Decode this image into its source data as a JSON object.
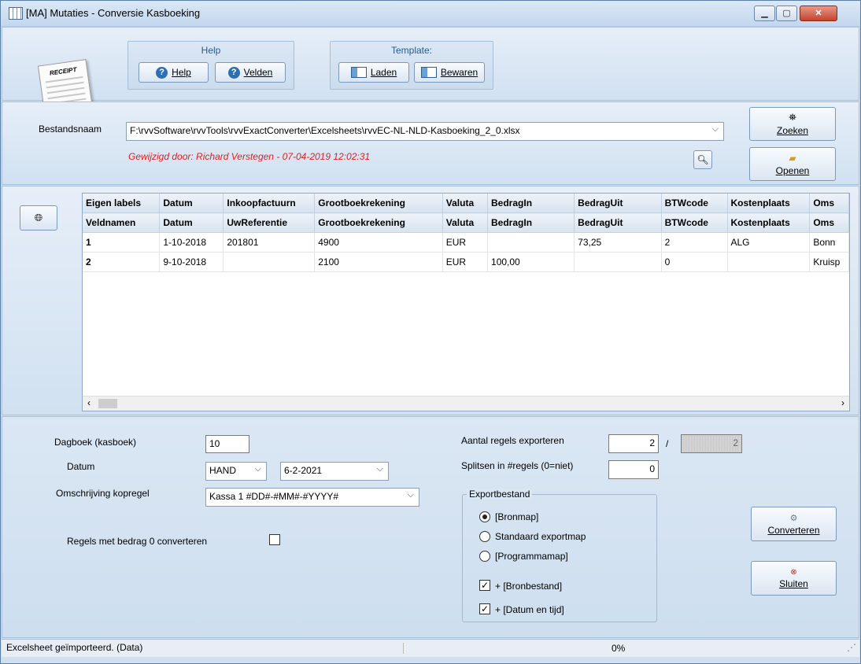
{
  "window": {
    "title": "[MA]  Mutaties - Conversie Kasboeking"
  },
  "toolbar": {
    "help_group_title": "Help",
    "help_button": "Help",
    "velden_button": "Velden",
    "template_group_title": "Template:",
    "laden_button": "Laden",
    "bewaren_button": "Bewaren",
    "receipt_text": "RECEIPT"
  },
  "file": {
    "label": "Bestandsnaam",
    "path": "F:\\rvvSoftware\\rvvTools\\rvvExactConverter\\Excelsheets\\rvvEC-NL-NLD-Kasboeking_2_0.xlsx",
    "modified_by": "Gewijzigd door: Richard Verstegen   -  07-04-2019  12:02:31",
    "zoeken_button": "Zoeken",
    "openen_button": "Openen"
  },
  "grid": {
    "header_eigen": [
      "Eigen labels",
      "Datum",
      "Inkoopfactuurn",
      "Grootboekrekening",
      "Valuta",
      "BedragIn",
      "BedragUit",
      "BTWcode",
      "Kostenplaats",
      "Oms"
    ],
    "header_veld": [
      "Veldnamen",
      "Datum",
      "UwReferentie",
      "Grootboekrekening",
      "Valuta",
      "BedragIn",
      "BedragUit",
      "BTWcode",
      "Kostenplaats",
      "Oms"
    ],
    "rows": [
      [
        "1",
        "1-10-2018",
        "201801",
        "4900",
        "EUR",
        "",
        "73,25",
        "2",
        "ALG",
        "Bonn"
      ],
      [
        "2",
        "9-10-2018",
        "",
        "2100",
        "EUR",
        "100,00",
        "",
        "0",
        "",
        "Kruisp"
      ]
    ]
  },
  "options": {
    "dagboek_label": "Dagboek (kasboek)",
    "dagboek_value": "10",
    "datum_label": "Datum",
    "datum_mode": "HAND",
    "datum_value": "6-2-2021",
    "omschrijving_label": "Omschrijving kopregel",
    "omschrijving_value": "Kassa 1 #DD#-#MM#-#YYYY#",
    "regels_nul_label": "Regels met bedrag 0 converteren",
    "aantal_label": "Aantal regels exporteren",
    "aantal_value": "2",
    "aantal_sep": "/",
    "aantal_total": "2",
    "splitsen_label": "Splitsen in #regels (0=niet)",
    "splitsen_value": "0",
    "export_legend": "Exportbestand",
    "radio_bronmap": "[Bronmap]",
    "radio_standaard": "Standaard exportmap",
    "radio_programma": "[Programmamap]",
    "check_bronbestand": "+ [Bronbestand]",
    "check_datum": "+ [Datum en tijd]",
    "converteren_button": "Converteren",
    "sluiten_button": "Sluiten"
  },
  "status": {
    "message": "Excelsheet geïmporteerd. (Data)",
    "progress": "0%"
  }
}
